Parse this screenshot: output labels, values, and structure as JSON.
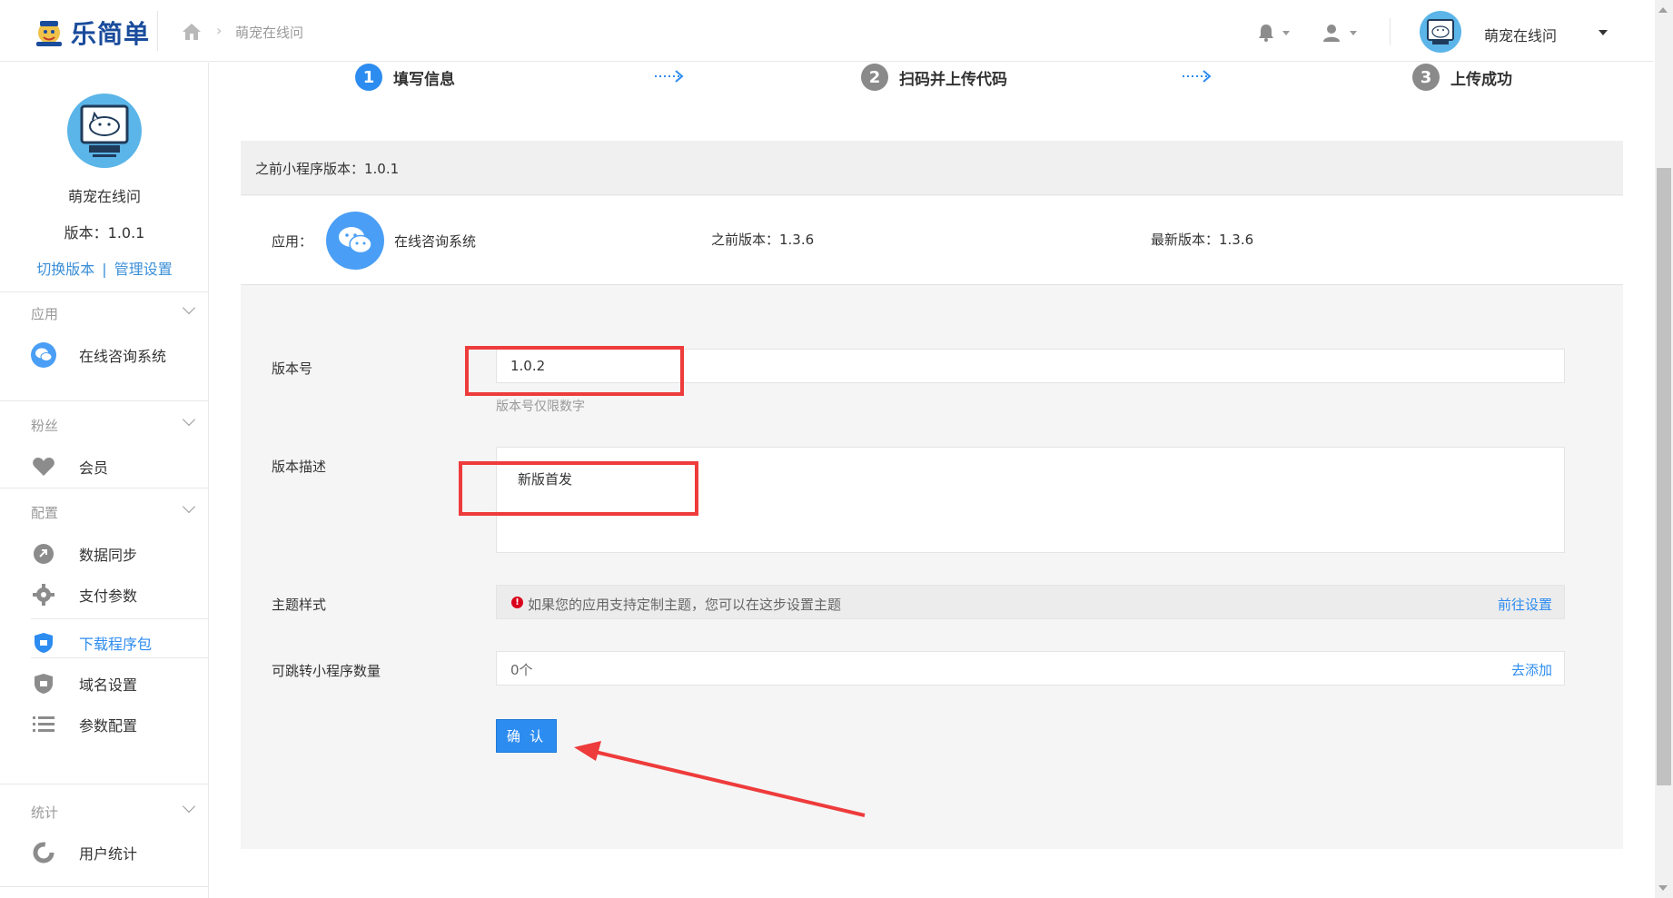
{
  "brand": {
    "logo_text": "乐简单",
    "accent": "#2d8cf0"
  },
  "breadcrumb": {
    "current": "萌宠在线问"
  },
  "topbar": {
    "user_name": "萌宠在线问"
  },
  "sidebar": {
    "profile_name": "萌宠在线问",
    "version": "版本：1.0.1",
    "switch_version": "切换版本",
    "separator": "|",
    "manage_settings": "管理设置",
    "sections": [
      {
        "title": "应用",
        "items": [
          {
            "label": "在线咨询系统",
            "icon": "wechat-icon"
          }
        ]
      },
      {
        "title": "粉丝",
        "items": [
          {
            "label": "会员",
            "icon": "heart-icon"
          }
        ]
      },
      {
        "title": "配置",
        "items": [
          {
            "label": "数据同步",
            "icon": "link-icon"
          },
          {
            "label": "支付参数",
            "icon": "gear-icon"
          },
          {
            "label": "下载程序包",
            "icon": "shield-icon",
            "active": true
          },
          {
            "label": "域名设置",
            "icon": "shield-icon"
          },
          {
            "label": "参数配置",
            "icon": "list-icon"
          }
        ]
      },
      {
        "title": "统计",
        "items": [
          {
            "label": "用户统计",
            "icon": "refresh-icon"
          }
        ]
      }
    ]
  },
  "steps": [
    {
      "num": "1",
      "label": "填写信息",
      "active": true
    },
    {
      "num": "2",
      "label": "扫码并上传代码",
      "active": false
    },
    {
      "num": "3",
      "label": "上传成功",
      "active": false
    }
  ],
  "content": {
    "prev_mini_version": "之前小程序版本：1.0.1",
    "app_label": "应用：",
    "app_name": "在线咨询系统",
    "app_prev_version": "之前版本：1.3.6",
    "app_latest_version": "最新版本：1.3.6",
    "form": {
      "version_label": "版本号",
      "version_value": "1.0.2",
      "version_hint": "版本号仅限数字",
      "desc_label": "版本描述",
      "desc_value": "新版首发",
      "theme_label": "主题样式",
      "theme_notice": "如果您的应用支持定制主题，您可以在这步设置主题",
      "theme_link": "前往设置",
      "jump_label": "可跳转小程序数量",
      "jump_value": "0个",
      "jump_link": "去添加",
      "confirm": "确 认"
    }
  },
  "colors": {
    "annotation_red": "#ee3b3b",
    "step_active": "#2d8cf0",
    "step_inactive": "#8a8a8a"
  }
}
